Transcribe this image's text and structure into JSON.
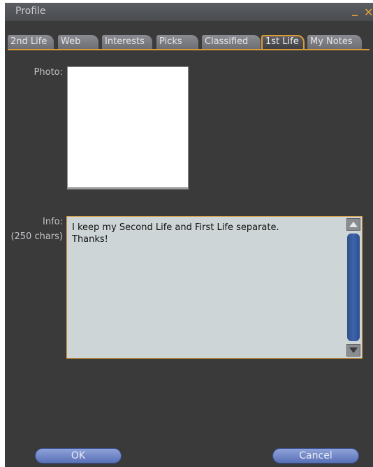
{
  "window": {
    "title": "Profile"
  },
  "tabs": [
    {
      "label": "2nd Life",
      "active": false
    },
    {
      "label": "Web",
      "active": false
    },
    {
      "label": "Interests",
      "active": false
    },
    {
      "label": "Picks",
      "active": false
    },
    {
      "label": "Classified",
      "active": false
    },
    {
      "label": "1st Life",
      "active": true
    },
    {
      "label": "My Notes",
      "active": false
    }
  ],
  "form": {
    "photo_label": "Photo:",
    "info_label": "Info:",
    "info_limit": "(250 chars)",
    "info_text": "I keep my Second Life and First Life separate.\nThanks!"
  },
  "buttons": {
    "ok": "OK",
    "cancel": "Cancel"
  },
  "colors": {
    "accent": "#d89a3a",
    "button": "#6b80c4",
    "panel": "#3a3a3a"
  }
}
